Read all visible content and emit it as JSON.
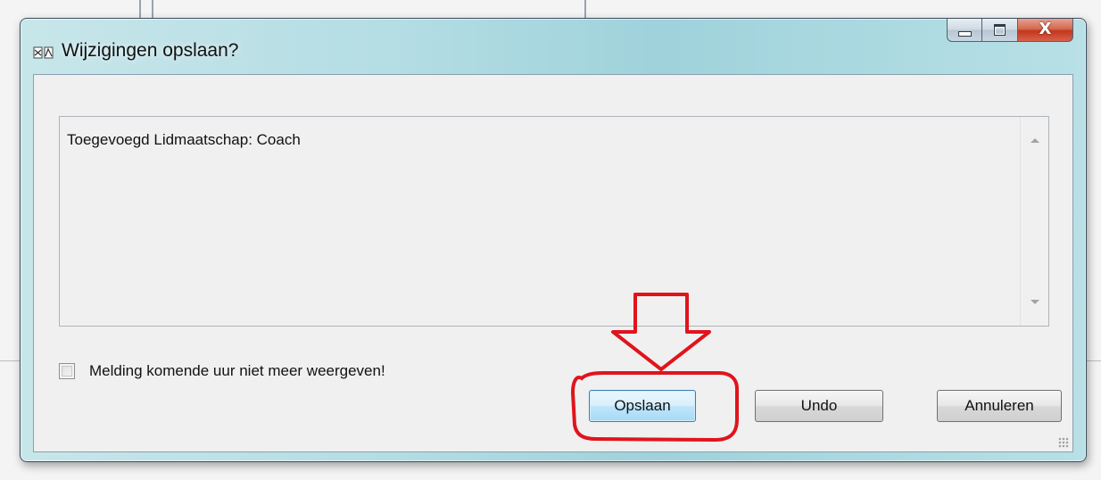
{
  "dialog": {
    "title": "Wijzigingen opslaan?",
    "caption_buttons": {
      "close_glyph": "X"
    },
    "message": "Toegevoegd Lidmaatschap: Coach",
    "checkbox_label": "Melding komende uur niet meer weergeven!",
    "checkbox_checked": false,
    "buttons": {
      "save": "Opslaan",
      "undo": "Undo",
      "cancel": "Annuleren"
    }
  },
  "annotation": {
    "color": "#e0141c",
    "shapes": [
      "arrow-down",
      "ellipse-around-save-button"
    ]
  },
  "colors": {
    "titlebar": "#b4dde4",
    "client": "#f0f0f0",
    "default_button_border": "#3c7fb1",
    "close_button": "#c3371c"
  }
}
